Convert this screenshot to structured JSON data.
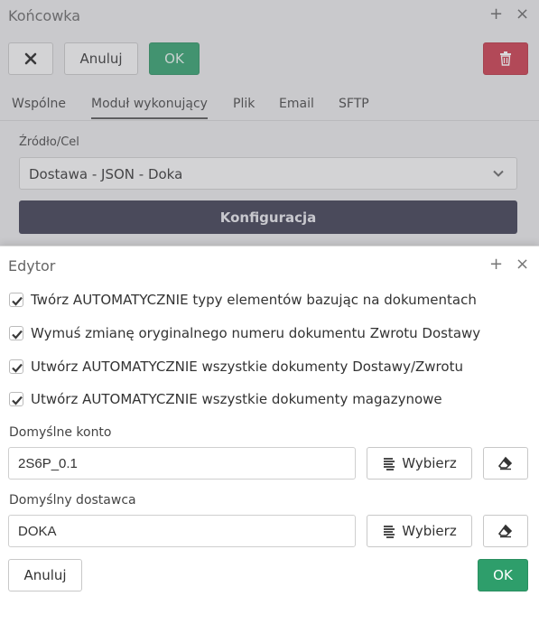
{
  "background_window": {
    "title": "Końcowka",
    "close_symbol": "×",
    "plus_symbol": "+",
    "toolbar": {
      "close_x_label": "✕",
      "cancel_label": "Anuluj",
      "ok_label": "OK",
      "delete_icon": "trash-icon"
    },
    "tabs": [
      {
        "label": "Wspólne",
        "active": false
      },
      {
        "label": "Moduł wykonujący",
        "active": true
      },
      {
        "label": "Plik",
        "active": false
      },
      {
        "label": "Email",
        "active": false
      },
      {
        "label": "SFTP",
        "active": false
      }
    ],
    "source_label": "Źródło/Cel",
    "source_value": "Dostawa - JSON - Doka",
    "config_button_label": "Konfiguracja"
  },
  "editor": {
    "title": "Edytor",
    "plus_symbol": "+",
    "close_symbol": "×",
    "checkboxes": [
      {
        "label": "Twórz AUTOMATYCZNIE typy elementów bazując na dokumentach",
        "checked": true
      },
      {
        "label": "Wymuś zmianę oryginalnego numeru dokumentu Zwrotu Dostawy",
        "checked": true
      },
      {
        "label": "Utwórz AUTOMATYCZNIE wszystkie dokumenty Dostawy/Zwrotu",
        "checked": true
      },
      {
        "label": "Utwórz AUTOMATYCZNIE wszystkie dokumenty magazynowe",
        "checked": true
      }
    ],
    "default_account": {
      "label": "Domyślne konto",
      "value": "2S6P_0.1",
      "pick_label": "Wybierz"
    },
    "default_supplier": {
      "label": "Domyślny dostawca",
      "value": "DOKA",
      "pick_label": "Wybierz"
    },
    "cancel_label": "Anuluj",
    "ok_label": "OK"
  },
  "colors": {
    "ok_green": "#2e9e6b",
    "delete_red": "#c9384a",
    "config_dark": "#3a3a4e",
    "checkbox_check": "#3a3a3a"
  }
}
